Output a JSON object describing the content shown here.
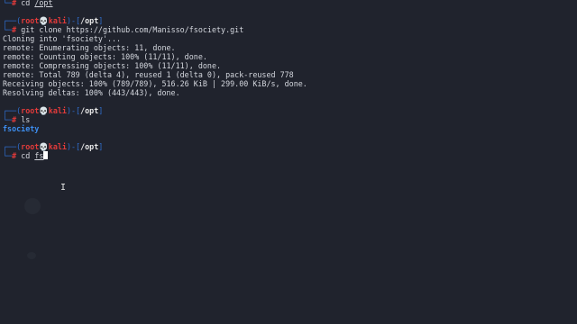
{
  "prompt": {
    "open": "┌──(",
    "user": "root",
    "skull": "💀",
    "host": "kali",
    "mid": ")-[",
    "close": "]",
    "branch": "└─",
    "dollar": "#"
  },
  "blocks": [
    {
      "path": "",
      "command": "cd /opt",
      "output": []
    },
    {
      "path": "/opt",
      "command": "git clone https://github.com/Manisso/fsociety.git",
      "output": [
        "Cloning into 'fsociety'...",
        "remote: Enumerating objects: 11, done.",
        "remote: Counting objects: 100% (11/11), done.",
        "remote: Compressing objects: 100% (11/11), done.",
        "remote: Total 789 (delta 4), reused 1 (delta 0), pack-reused 778",
        "Receiving objects: 100% (789/789), 516.26 KiB | 299.00 KiB/s, done.",
        "Resolving deltas: 100% (443/443), done."
      ]
    },
    {
      "path": "/opt",
      "command": "ls",
      "dir_listing": "fsociety"
    },
    {
      "path": "/opt",
      "command_prefix": "cd ",
      "command_typed": "fs"
    }
  ],
  "first_line": {
    "branch": "└─",
    "dollar": "#",
    "cd": "cd ",
    "arg": "/opt"
  },
  "colors": {
    "background": "#20232d",
    "prompt_frame": "#2f6fd1",
    "prompt_user": "#e23b3b",
    "directory": "#3d8ef0",
    "text": "#d4d7de"
  },
  "mouse_cursor_icon": "I"
}
